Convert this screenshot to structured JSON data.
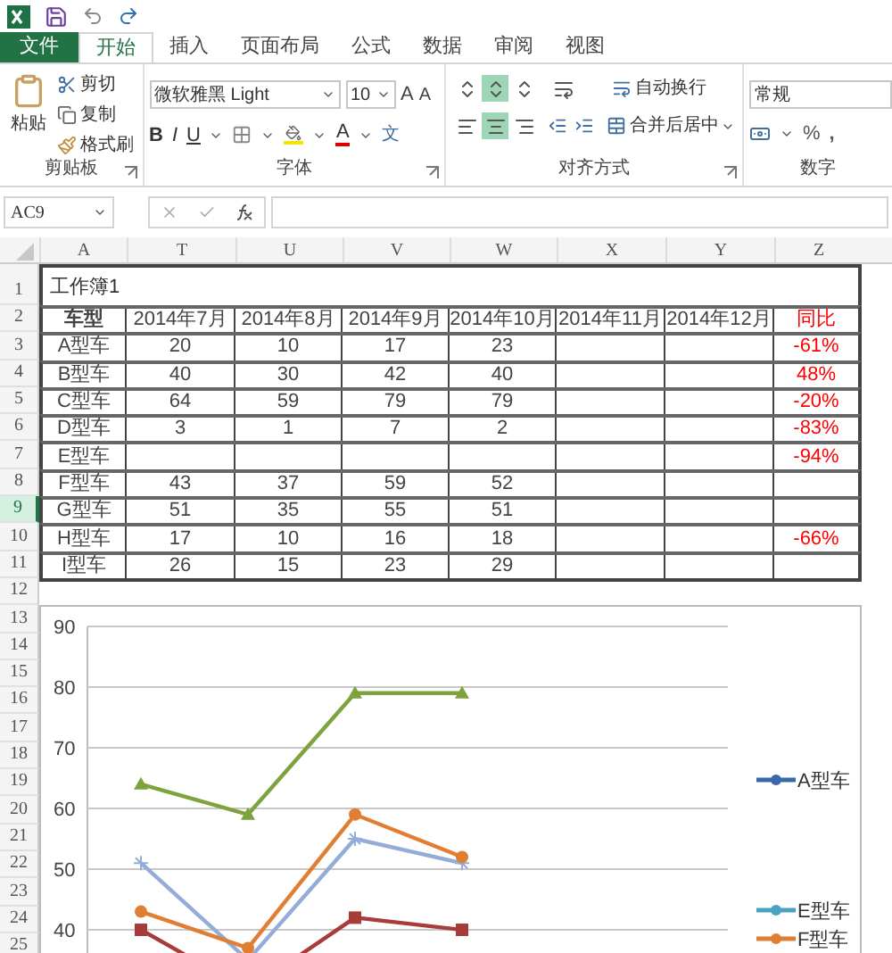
{
  "tabs": [
    {
      "label": "文件",
      "kind": "file",
      "selected": false
    },
    {
      "label": "开始",
      "kind": "tab",
      "selected": true
    },
    {
      "label": "插入",
      "kind": "tab",
      "selected": false
    },
    {
      "label": "页面布局",
      "kind": "tab",
      "selected": false
    },
    {
      "label": "公式",
      "kind": "tab",
      "selected": false
    },
    {
      "label": "数据",
      "kind": "tab",
      "selected": false
    },
    {
      "label": "审阅",
      "kind": "tab",
      "selected": false
    },
    {
      "label": "视图",
      "kind": "tab",
      "selected": false
    }
  ],
  "ribbon": {
    "clipboard": {
      "paste": "粘贴",
      "cut": "剪切",
      "copy": "复制",
      "format_painter": "格式刷",
      "label": "剪贴板"
    },
    "font": {
      "font_name": "微软雅黑 Light",
      "font_size": "10",
      "grow": "A",
      "shrink": "A",
      "bold": "B",
      "italic": "I",
      "underline": "U",
      "font_color": "A",
      "phonetic": "文",
      "label": "字体"
    },
    "alignment": {
      "vertical": [
        {
          "selected": false
        },
        {
          "selected": true
        },
        {
          "selected": false
        }
      ],
      "horizontal": [
        {
          "selected": false
        },
        {
          "selected": true
        },
        {
          "selected": false
        }
      ],
      "wrap_text": "自动换行",
      "merge_center": "合并后居中",
      "label": "对齐方式"
    },
    "number": {
      "format": "常规",
      "percent": "%",
      "comma": ",",
      "label": "数字"
    }
  },
  "formula_bar": {
    "name_box": "AC9"
  },
  "sheet": {
    "columns": [
      "A",
      "T",
      "U",
      "V",
      "W",
      "X",
      "Y",
      "Z"
    ],
    "row_headers": [
      {
        "label": "1",
        "selected": false
      },
      {
        "label": "2",
        "selected": false
      },
      {
        "label": "3",
        "selected": false
      },
      {
        "label": "4",
        "selected": false
      },
      {
        "label": "5",
        "selected": false
      },
      {
        "label": "6",
        "selected": false
      },
      {
        "label": "7",
        "selected": false
      },
      {
        "label": "8",
        "selected": false
      },
      {
        "label": "9",
        "selected": true
      },
      {
        "label": "10",
        "selected": false
      },
      {
        "label": "11",
        "selected": false
      },
      {
        "label": "12",
        "selected": false
      },
      {
        "label": "13",
        "selected": false
      },
      {
        "label": "14",
        "selected": false
      },
      {
        "label": "15",
        "selected": false
      },
      {
        "label": "16",
        "selected": false
      },
      {
        "label": "17",
        "selected": false
      },
      {
        "label": "18",
        "selected": false
      },
      {
        "label": "19",
        "selected": false
      },
      {
        "label": "20",
        "selected": false
      },
      {
        "label": "21",
        "selected": false
      },
      {
        "label": "22",
        "selected": false
      },
      {
        "label": "23",
        "selected": false
      },
      {
        "label": "24",
        "selected": false
      },
      {
        "label": "25",
        "selected": false
      }
    ],
    "title": "工作簿1",
    "header": [
      "车型",
      "2014年7月",
      "2014年8月",
      "2014年9月",
      "2014年10月",
      "2014年11月",
      "2014年12月",
      "同比"
    ],
    "rows": [
      [
        "A型车",
        "20",
        "10",
        "17",
        "23",
        "",
        "",
        "-61%"
      ],
      [
        "B型车",
        "40",
        "30",
        "42",
        "40",
        "",
        "",
        "48%"
      ],
      [
        "C型车",
        "64",
        "59",
        "79",
        "79",
        "",
        "",
        "-20%"
      ],
      [
        "D型车",
        "3",
        "1",
        "7",
        "2",
        "",
        "",
        "-83%"
      ],
      [
        "E型车",
        "",
        "",
        "",
        "",
        "",
        "",
        "-94%"
      ],
      [
        "F型车",
        "43",
        "37",
        "59",
        "52",
        "",
        "",
        ""
      ],
      [
        "G型车",
        "51",
        "35",
        "55",
        "51",
        "",
        "",
        ""
      ],
      [
        "H型车",
        "17",
        "10",
        "16",
        "18",
        "",
        "",
        "-66%"
      ],
      [
        "I型车",
        "26",
        "15",
        "23",
        "29",
        "",
        "",
        ""
      ]
    ]
  },
  "chart": {
    "chart_data": {
      "type": "line",
      "ylim": [
        30,
        90
      ],
      "yticks": [
        40,
        50,
        60,
        70,
        80,
        90
      ],
      "grid": true,
      "series": [
        {
          "color": "#7ea23e",
          "marker": "triangle",
          "values": [
            64,
            59,
            79,
            79
          ]
        },
        {
          "color": "#94acd8",
          "marker": "cross",
          "values": [
            51,
            35,
            55,
            51
          ]
        },
        {
          "color": "#e07e33",
          "marker": "circle",
          "values": [
            43,
            37,
            59,
            52
          ]
        },
        {
          "color": "#a83c3a",
          "marker": "square",
          "values": [
            40,
            30,
            42,
            40
          ]
        }
      ]
    },
    "legend": [
      {
        "label": "A型车",
        "color": "#3a68a8"
      },
      {
        "label": "E型车",
        "color": "#4aa3c0"
      },
      {
        "label": "F型车",
        "color": "#e07e33"
      }
    ]
  }
}
